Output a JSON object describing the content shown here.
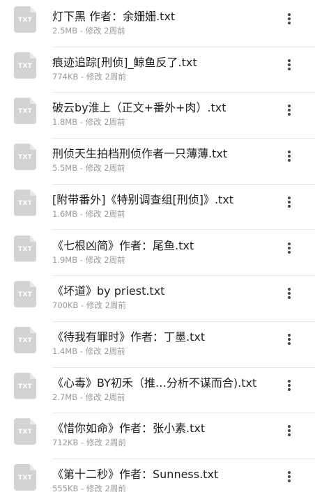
{
  "files": [
    {
      "name": "灯下黑 作者：余姗姗.txt",
      "size": "2.5MB",
      "modified": "修改 2周前",
      "icon": "txt-file-icon",
      "type_label": "TXT"
    },
    {
      "name": "痕迹追踪[刑侦]_鲸鱼反了.txt",
      "size": "774KB",
      "modified": "修改 2周前",
      "icon": "txt-file-icon",
      "type_label": "TXT"
    },
    {
      "name": "破云by淮上（正文+番外+肉）.txt",
      "size": "1.8MB",
      "modified": "修改 2周前",
      "icon": "txt-file-icon",
      "type_label": "TXT"
    },
    {
      "name": "刑侦天生拍档刑侦作者一只薄薄.txt",
      "size": "5.5MB",
      "modified": "修改 2周前",
      "icon": "txt-file-icon",
      "type_label": "TXT"
    },
    {
      "name": "[附带番外]《特别调查组[刑侦]》.txt",
      "size": "1.6MB",
      "modified": "修改 2周前",
      "icon": "txt-file-icon",
      "type_label": "TXT"
    },
    {
      "name": "《七根凶简》作者：尾鱼.txt",
      "size": "1.9MB",
      "modified": "修改 2周前",
      "icon": "txt-file-icon",
      "type_label": "TXT"
    },
    {
      "name": "《坏道》by priest.txt",
      "size": "700KB",
      "modified": "修改 2周前",
      "icon": "txt-file-icon",
      "type_label": "TXT"
    },
    {
      "name": "《待我有罪时》作者：丁墨.txt",
      "size": "1.4MB",
      "modified": "修改 2周前",
      "icon": "txt-file-icon",
      "type_label": "TXT"
    },
    {
      "name": "《心毒》BY初禾（推…分析不谋而合).txt",
      "size": "2.7MB",
      "modified": "修改 2周前",
      "icon": "txt-file-icon",
      "type_label": "TXT"
    },
    {
      "name": "《惜你如命》作者：张小素.txt",
      "size": "712KB",
      "modified": "修改 2周前",
      "icon": "txt-file-icon",
      "type_label": "TXT"
    },
    {
      "name": "《第十二秒》作者：Sunness.txt",
      "size": "555KB",
      "modified": "修改 2周前",
      "icon": "txt-file-icon",
      "type_label": "TXT"
    }
  ],
  "meta_separator": " - ",
  "more_icon": "more-vertical-icon"
}
